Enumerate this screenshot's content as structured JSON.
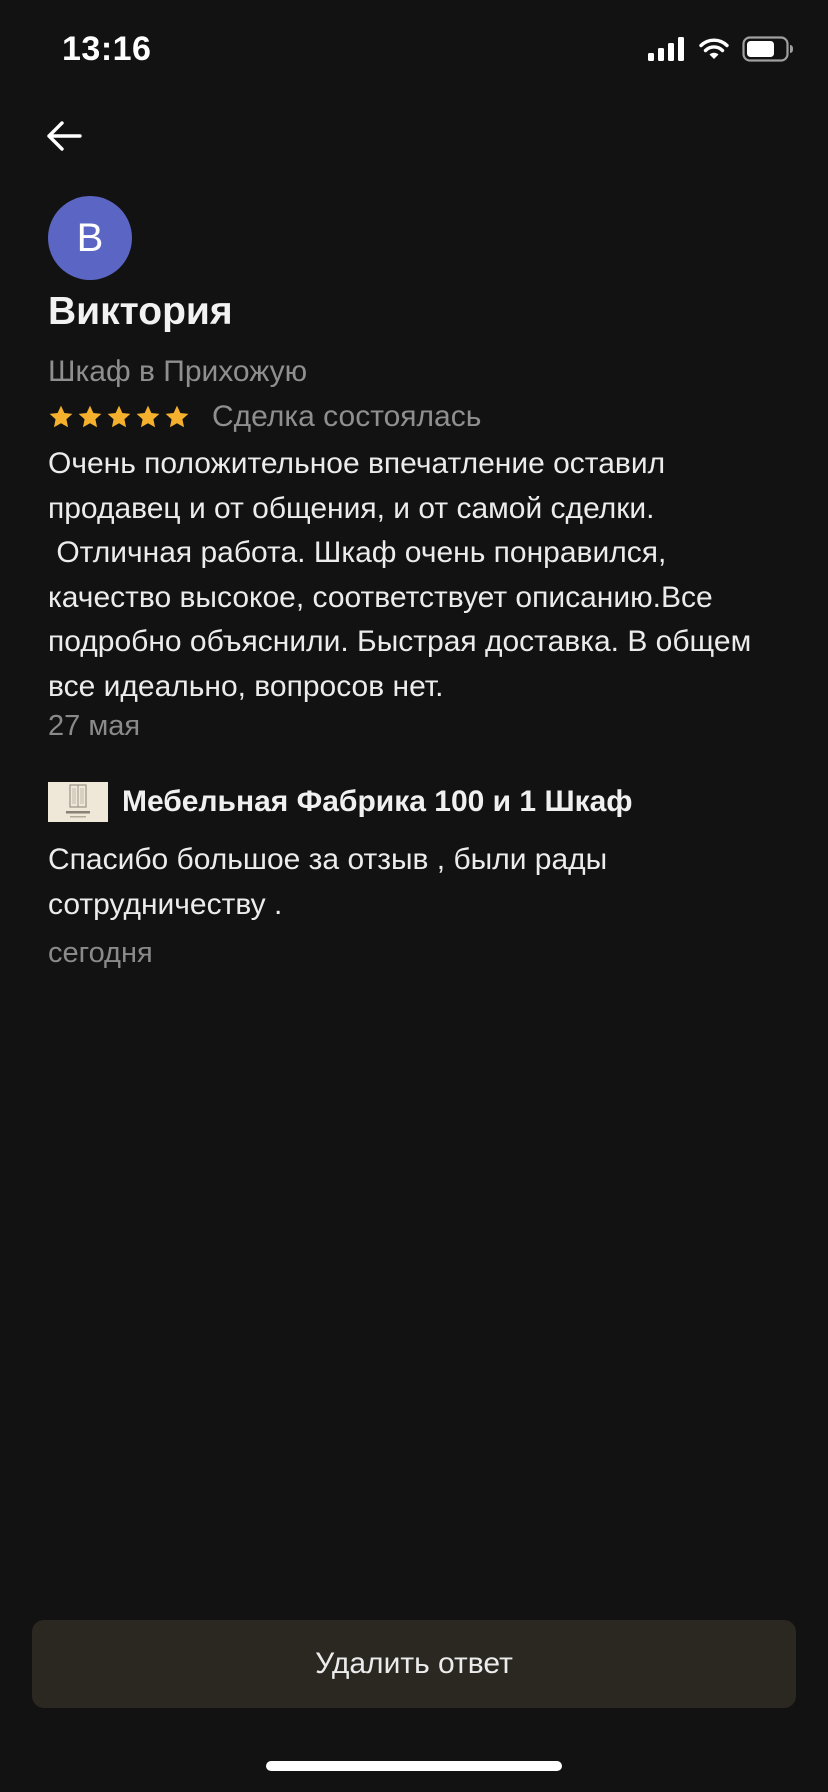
{
  "status_bar": {
    "time": "13:16"
  },
  "icons": {
    "back": "arrow-left-icon",
    "signal": "cellular-signal-icon",
    "wifi": "wifi-icon",
    "battery": "battery-icon",
    "star": "star-icon"
  },
  "colors": {
    "background": "#121212",
    "avatar": "#5b66c4",
    "star": "#f5b02e",
    "button_bg": "#2b2822",
    "secondary_text": "#8f8f8f"
  },
  "review": {
    "avatar_letter": "В",
    "reviewer_name": "Виктория",
    "product": "Шкаф в Прихожую",
    "rating": 5,
    "rating_max": 5,
    "deal_status": "Сделка состоялась",
    "text": "Очень положительное впечатление оставил продавец и от общения, и от самой сделки.\n Отличная работа. Шкаф очень понравился, качество высокое, соответствует описанию.Все подробно объяснили. Быстрая доставка. В общем все идеально, вопросов нет.",
    "date": "27 мая"
  },
  "reply": {
    "seller_name": "Мебельная Фабрика 100 и 1 Шкаф",
    "text": "Спасибо большое за отзыв , были рады сотрудничеству .",
    "date": "сегодня"
  },
  "actions": {
    "delete_reply_label": "Удалить ответ"
  }
}
